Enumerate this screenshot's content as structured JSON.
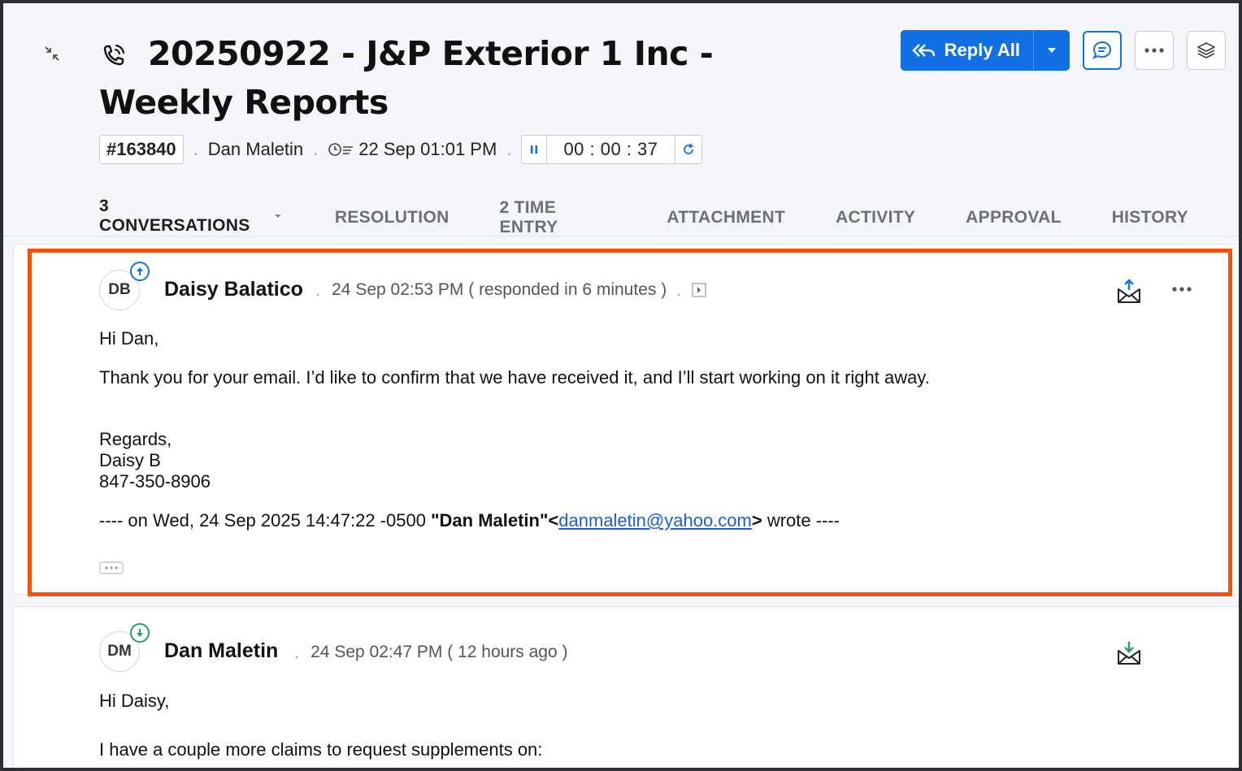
{
  "ticket": {
    "title": "20250922 - J&P Exterior 1 Inc - Weekly Reports",
    "id": "#163840",
    "contact": "Dan Maletin",
    "due": "22 Sep 01:01 PM",
    "timer": "00 : 00 : 37"
  },
  "actions": {
    "reply_all_label": "Reply All"
  },
  "tabs": [
    {
      "label": "3 CONVERSATIONS"
    },
    {
      "label": "RESOLUTION"
    },
    {
      "label": "2 TIME ENTRY"
    },
    {
      "label": "ATTACHMENT"
    },
    {
      "label": "ACTIVITY"
    },
    {
      "label": "APPROVAL"
    },
    {
      "label": "HISTORY"
    }
  ],
  "conversations": [
    {
      "initials": "DB",
      "sender": "Daisy Balatico",
      "time": "24 Sep 02:53 PM ( responded in 6 minutes )",
      "greeting": "Hi Dan,",
      "line1": "Thank you for your email. I’d like to confirm that we have received it, and I’ll start working on it right away.",
      "regards": "Regards,",
      "signature_name": "Daisy B",
      "signature_phone": "847-350-8906",
      "quote_prefix": "---- on Wed, 24 Sep 2025 14:47:22 -0500 ",
      "quote_name": "\"Dan Maletin\"",
      "quote_lt": "<",
      "quote_email": "danmaletin@yahoo.com",
      "quote_gt": ">",
      "quote_suffix": " wrote ----",
      "badge_color": "#1170e4"
    },
    {
      "initials": "DM",
      "sender": "Dan Maletin",
      "time": "24 Sep 02:47 PM ( 12 hours ago )",
      "greeting": "Hi Daisy,",
      "line1": "I have a couple more claims to request supplements on:",
      "badge_color": "#21a35b"
    }
  ]
}
